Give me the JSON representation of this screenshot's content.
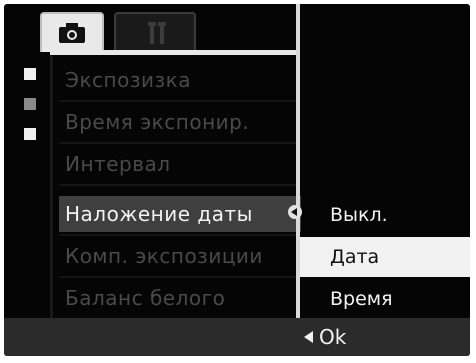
{
  "tabs": [
    {
      "name": "camera",
      "icon": "camera-icon",
      "active": true
    },
    {
      "name": "setup",
      "icon": "wrench-icon",
      "active": false
    }
  ],
  "menu": {
    "items": [
      {
        "label": "Экспозизка"
      },
      {
        "label": "Время экспонир."
      },
      {
        "label": "Интервал"
      },
      {
        "label": "Наложение даты"
      },
      {
        "label": "Комп. экспозиции"
      },
      {
        "label": "Баланс белого"
      }
    ],
    "active_index": 3
  },
  "submenu": {
    "options": [
      {
        "label": "Выкл."
      },
      {
        "label": "Дата"
      },
      {
        "label": "Время"
      }
    ],
    "selected_index": 1
  },
  "footer": {
    "ok_label": "Ok"
  },
  "colors": {
    "background": "#050505",
    "highlight": "#3f3f3f",
    "selected_option": "#f2f2f2"
  }
}
